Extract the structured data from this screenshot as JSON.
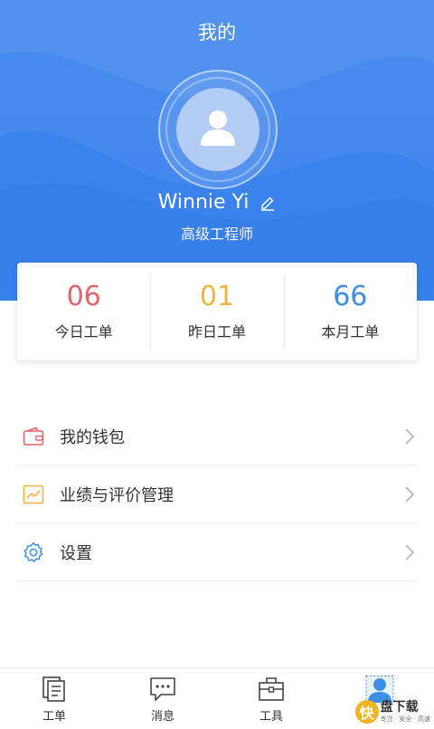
{
  "header": {
    "title": "我的",
    "background_color": "#3b84ee",
    "user": {
      "name": "Winnie Yi",
      "role": "高级工程师",
      "avatar_icon": "person-icon",
      "edit_icon": "pencil-icon"
    }
  },
  "stats": [
    {
      "value": "06",
      "label": "今日工单",
      "color": "#e4636a"
    },
    {
      "value": "01",
      "label": "昨日工单",
      "color": "#f0b43c"
    },
    {
      "value": "66",
      "label": "本月工单",
      "color": "#3b8fe6"
    }
  ],
  "menu": [
    {
      "label": "我的钱包",
      "icon": "wallet-icon",
      "color": "#e4636a"
    },
    {
      "label": "业绩与评价管理",
      "icon": "chart-icon",
      "color": "#f0b43c"
    },
    {
      "label": "设置",
      "icon": "gear-icon",
      "color": "#3b8fe6"
    }
  ],
  "tabbar": [
    {
      "label": "工单",
      "icon": "document-icon",
      "active": false
    },
    {
      "label": "消息",
      "icon": "message-icon",
      "active": false
    },
    {
      "label": "工具",
      "icon": "toolbox-icon",
      "active": false
    },
    {
      "label": "",
      "icon": "profile-icon",
      "active": true
    }
  ],
  "watermark": {
    "badge": "快",
    "main": "盘下载",
    "sub": "专注 · 安全 · 高速"
  }
}
